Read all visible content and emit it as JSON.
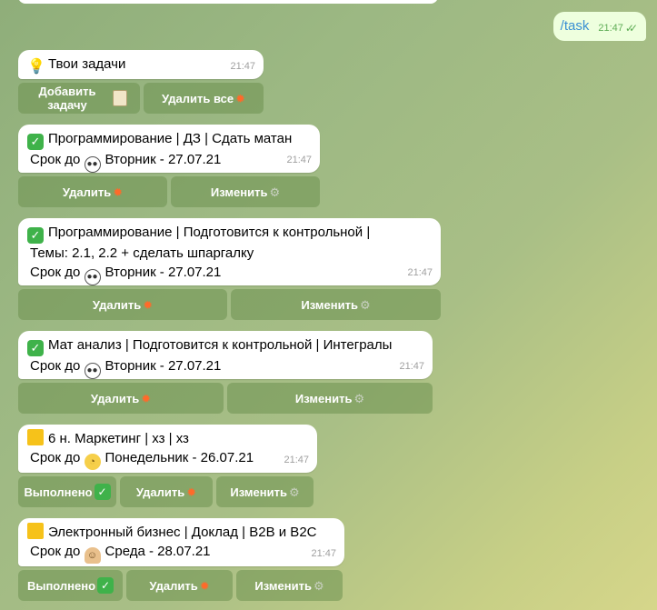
{
  "outgoing": {
    "text": "/task",
    "time": "21:47",
    "ticks": "✓✓"
  },
  "header_msg": {
    "text": "Твои задачи",
    "time": "21:47",
    "icon": "lightbulb-icon"
  },
  "header_buttons": {
    "add": "Добавить задачу",
    "delete_all": "Удалить все"
  },
  "tasks": [
    {
      "status_icon": "check-icon",
      "lines": [
        "Программирование | ДЗ | Сдать матан"
      ],
      "due_prefix": "Срок до",
      "due_icon": "panda-icon",
      "due": "Вторник - 27.07.21",
      "time": "21:47",
      "buttons": {
        "delete": "Удалить",
        "edit": "Изменить"
      }
    },
    {
      "status_icon": "check-icon",
      "lines": [
        "Программирование | Подготовится к контрольной |",
        "Темы: 2.1, 2.2 + сделать шпаргалку"
      ],
      "due_prefix": "Срок до",
      "due_icon": "panda-icon",
      "due": "Вторник - 27.07.21",
      "time": "21:47",
      "buttons": {
        "delete": "Удалить",
        "edit": "Изменить"
      }
    },
    {
      "status_icon": "check-icon",
      "lines": [
        "Мат анализ | Подготовится к контрольной | Интегралы"
      ],
      "due_prefix": "Срок до",
      "due_icon": "panda-icon",
      "due": "Вторник - 27.07.21",
      "time": "21:47",
      "buttons": {
        "delete": "Удалить",
        "edit": "Изменить"
      }
    },
    {
      "status_icon": "yellow-square-icon",
      "lines": [
        "6 н. Маркетинг | хз | хз"
      ],
      "due_prefix": "Срок до",
      "due_icon": "face-icon",
      "due": "Понедельник - 26.07.21",
      "time": "21:47",
      "buttons": {
        "done": "Выполнено",
        "delete": "Удалить",
        "edit": "Изменить"
      }
    },
    {
      "status_icon": "yellow-square-icon",
      "lines": [
        "Электронный бизнес | Доклад | B2B и B2C"
      ],
      "due_prefix": "Срок до",
      "due_icon": "person-icon",
      "due": "Среда - 28.07.21",
      "time": "21:47",
      "buttons": {
        "done": "Выполнено",
        "delete": "Удалить",
        "edit": "Изменить"
      }
    }
  ]
}
